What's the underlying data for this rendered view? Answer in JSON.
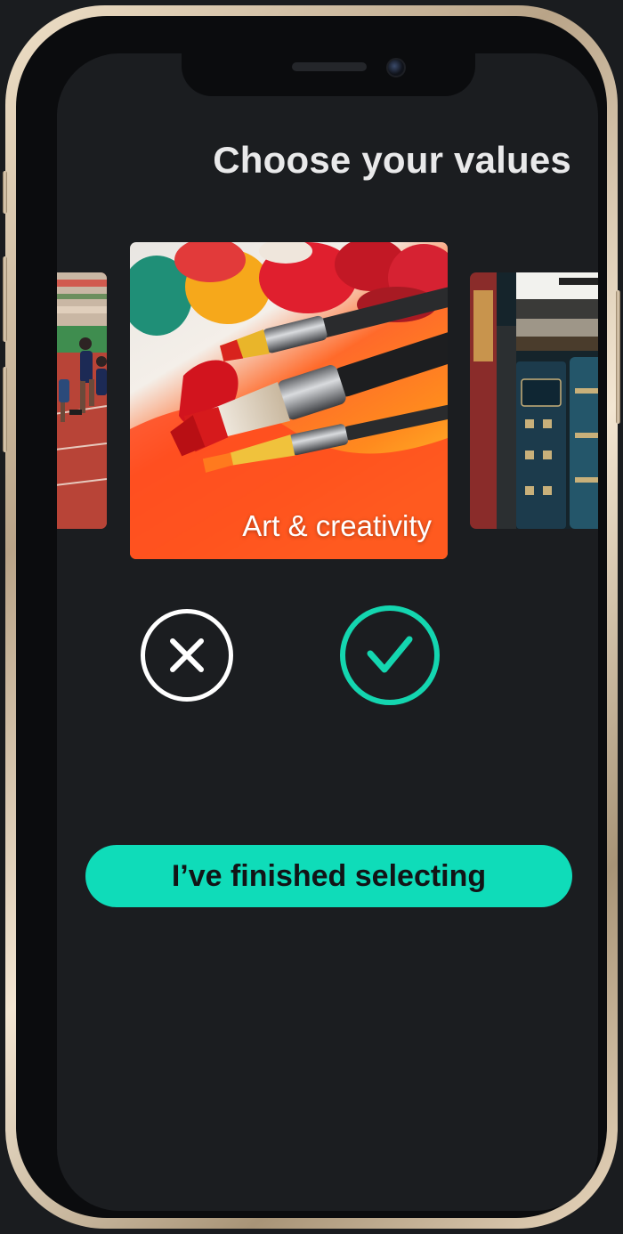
{
  "header": {
    "title": "Choose your values"
  },
  "carousel": {
    "previous_card": {
      "image": "sprinters-on-track-photo"
    },
    "current_card": {
      "label": "Art & creativity",
      "image": "paint-brushes-photo"
    },
    "next_card": {
      "image": "old-books-photo"
    }
  },
  "actions": {
    "reject_icon": "close-icon",
    "accept_icon": "checkmark-icon",
    "finish_label": "I’ve finished selecting"
  },
  "colors": {
    "accent": "#0fdcb9",
    "background": "#1b1d20",
    "title_text": "#e9e9ea"
  }
}
